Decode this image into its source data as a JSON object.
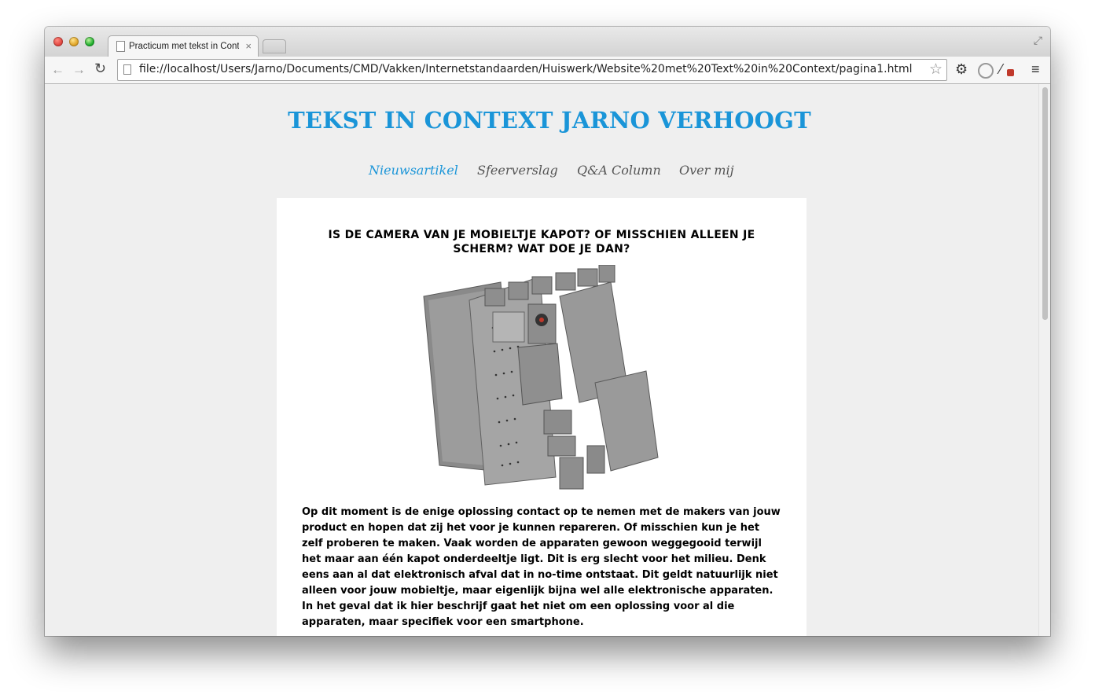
{
  "browser": {
    "tab_title": "Practicum met tekst in Context",
    "url": "file://localhost/Users/Jarno/Documents/CMD/Vakken/Internetstandaarden/Huiswerk/Website%20met%20Text%20in%20Context/pagina1.html"
  },
  "site": {
    "title": "TEKST IN CONTEXT JARNO VERHOOGT",
    "nav": [
      {
        "label": "Nieuwsartikel"
      },
      {
        "label": "Sfeerverslag"
      },
      {
        "label": "Q&A Column"
      },
      {
        "label": "Over mij"
      }
    ]
  },
  "article": {
    "headline": "IS DE CAMERA VAN JE MOBIELTJE KAPOT? OF MISSCHIEN ALLEEN JE SCHERM? WAT DOE JE DAN?",
    "body": "Op dit moment is de enige oplossing contact op te nemen met de makers van jouw product en hopen dat zij het voor je kunnen repareren. Of misschien kun je het zelf proberen te maken. Vaak worden de apparaten gewoon weggegooid terwijl het maar aan één kapot onderdeeltje ligt. Dit is erg slecht voor het milieu. Denk eens aan al dat elektronisch afval dat in no-time ontstaat. Dit geldt natuurlijk niet alleen voor jouw mobieltje, maar eigenlijk bijna wel alle elektronische apparaten. In het geval dat ik hier beschrijf gaat het niet om een oplossing voor al die apparaten, maar specifiek voor een smartphone."
  },
  "colors": {
    "accent": "#1a95d8",
    "page_bg": "#efefef",
    "nav_text": "#555555"
  }
}
